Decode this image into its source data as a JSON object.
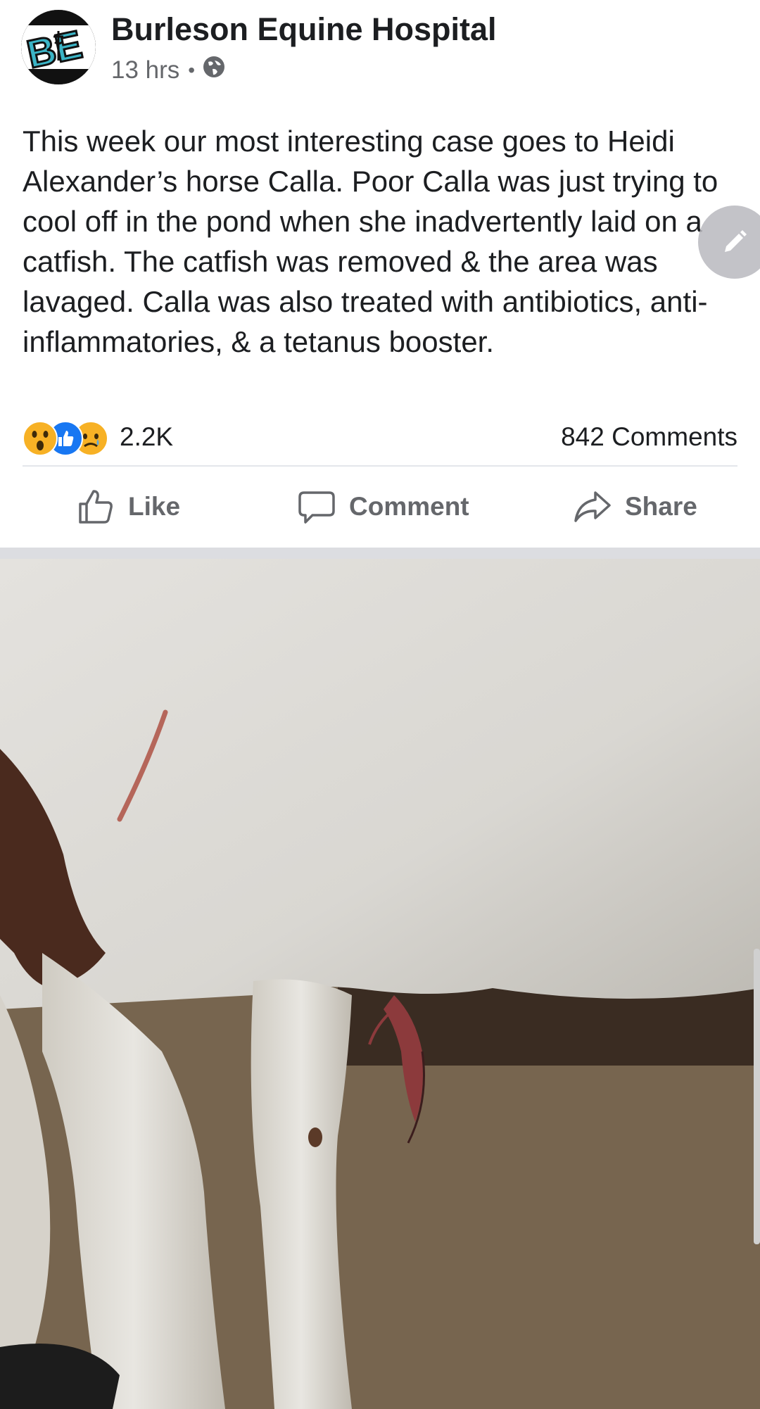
{
  "post": {
    "page_name": "Burleson Equine Hospital",
    "time": "13 hrs",
    "separator": "•",
    "audience_icon": "globe-icon",
    "text": "This week our most interesting case goes to Heidi Alexander’s horse Calla. Poor Calla was just trying to cool off in the pond when she inadvertently laid on a catfish. The catfish was removed & the area was lavaged.  Calla was also treated with antibiotics, anti-inflammatories, & a tetanus booster."
  },
  "reactions": {
    "icons": [
      "wow-reaction-icon",
      "like-reaction-icon",
      "sad-reaction-icon"
    ],
    "count": "2.2K",
    "comments": "842 Comments"
  },
  "actions": {
    "like": "Like",
    "comment": "Comment",
    "share": "Share"
  },
  "colors": {
    "text": "#1c1e21",
    "secondary": "#65676b",
    "like_blue": "#1877f2",
    "avatar_teal": "#3bb4c6"
  }
}
